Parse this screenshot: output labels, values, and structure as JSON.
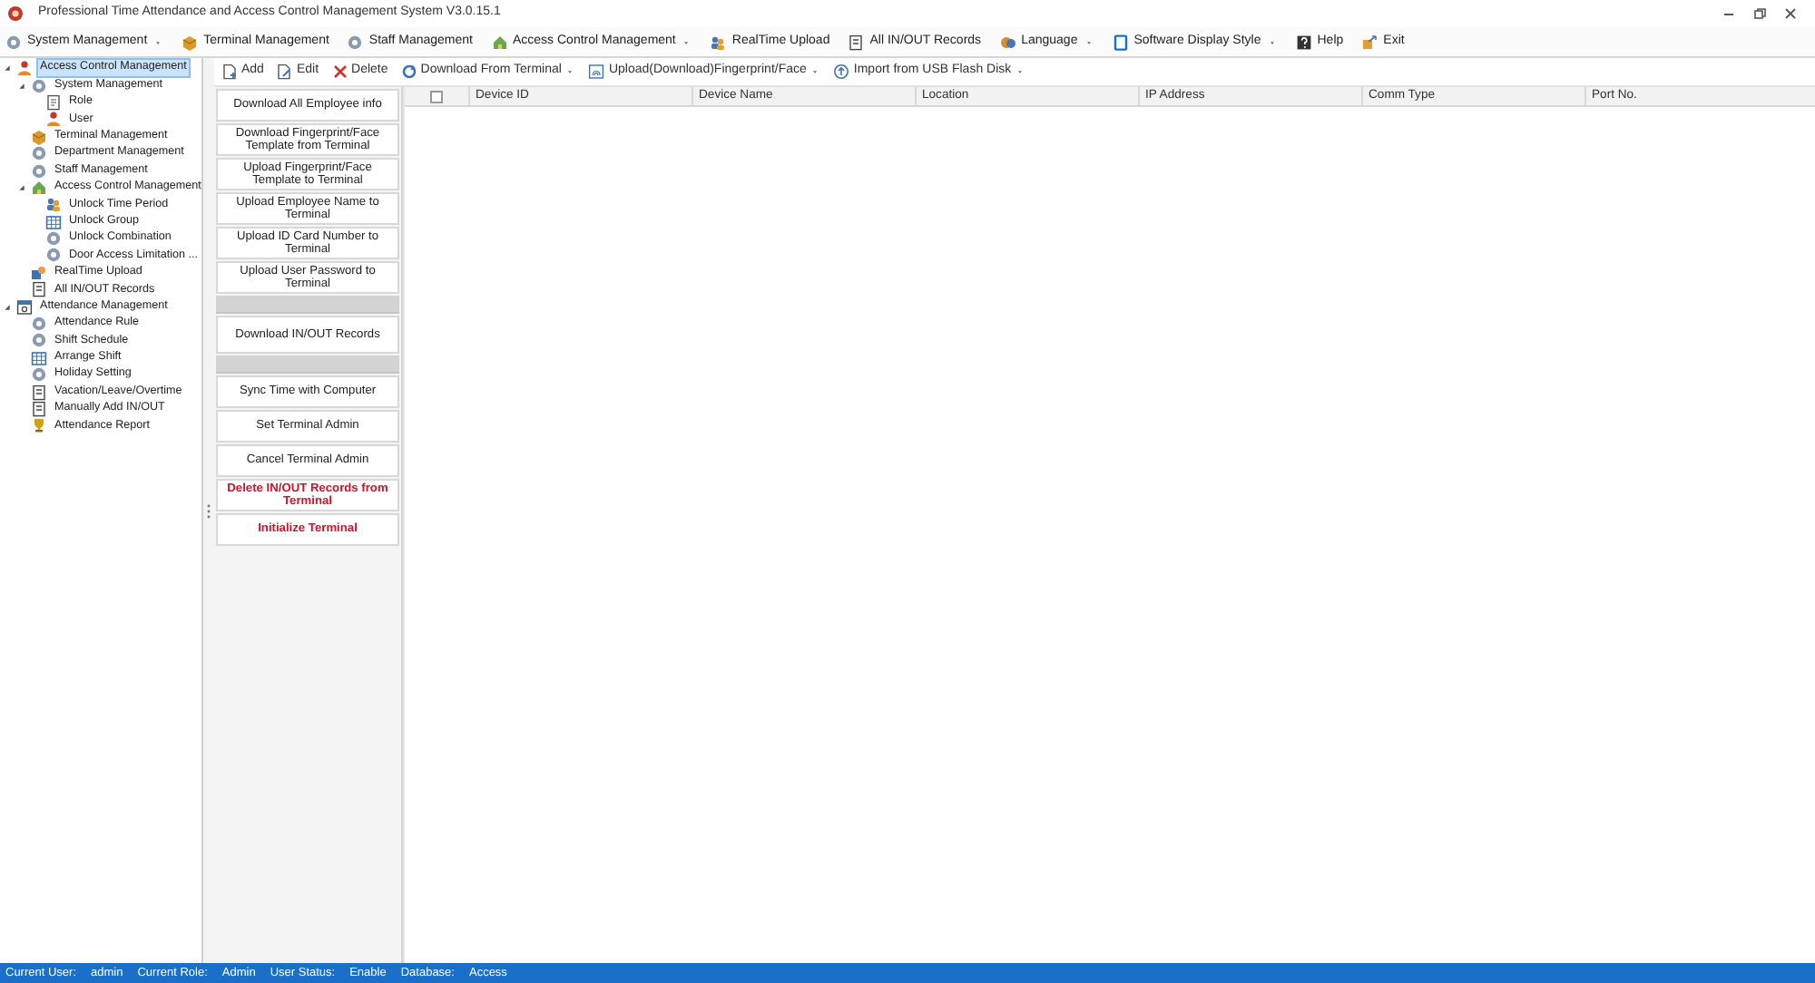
{
  "window": {
    "title": "Professional Time Attendance and Access Control Management System V3.0.15.1"
  },
  "menu": [
    {
      "label": "System Management",
      "dropdown": true
    },
    {
      "label": "Terminal Management",
      "dropdown": false
    },
    {
      "label": "Staff Management",
      "dropdown": false
    },
    {
      "label": "Access Control Management",
      "dropdown": true
    },
    {
      "label": "RealTime Upload",
      "dropdown": false
    },
    {
      "label": "All IN/OUT Records",
      "dropdown": false
    },
    {
      "label": "Language",
      "dropdown": true
    },
    {
      "label": "Software Display Style",
      "dropdown": true
    },
    {
      "label": "Help",
      "dropdown": false
    },
    {
      "label": "Exit",
      "dropdown": false
    }
  ],
  "tree": [
    {
      "label": "Access Control Management",
      "selected": true,
      "expanded": true,
      "children": [
        {
          "label": "System Management",
          "selected": false,
          "expanded": true,
          "children": [
            {
              "label": "Role",
              "selected": false
            },
            {
              "label": "User",
              "selected": false
            }
          ]
        },
        {
          "label": "Terminal Management",
          "selected": false
        },
        {
          "label": "Department Management",
          "selected": false
        },
        {
          "label": "Staff Management",
          "selected": false
        },
        {
          "label": "Access Control Management",
          "selected": false,
          "expanded": true,
          "children": [
            {
              "label": "Unlock Time Period",
              "selected": false
            },
            {
              "label": "Unlock Group",
              "selected": false
            },
            {
              "label": "Unlock Combination",
              "selected": false
            },
            {
              "label": "Door Access Limitation ...",
              "selected": false
            }
          ]
        },
        {
          "label": "RealTime Upload",
          "selected": false
        },
        {
          "label": "All IN/OUT Records",
          "selected": false
        }
      ]
    },
    {
      "label": "Attendance Management",
      "selected": false,
      "expanded": true,
      "children": [
        {
          "label": "Attendance Rule",
          "selected": false
        },
        {
          "label": "Shift Schedule",
          "selected": false
        },
        {
          "label": "Arrange Shift",
          "selected": false
        },
        {
          "label": "Holiday Setting",
          "selected": false
        },
        {
          "label": "Vacation/Leave/Overtime",
          "selected": false
        },
        {
          "label": "Manually Add IN/OUT",
          "selected": false
        },
        {
          "label": "Attendance Report",
          "selected": false
        }
      ]
    }
  ],
  "toolbar": [
    {
      "label": "Add",
      "dropdown": false
    },
    {
      "label": "Edit",
      "dropdown": false
    },
    {
      "label": "Delete",
      "dropdown": false
    },
    {
      "label": "Download From Terminal",
      "dropdown": true
    },
    {
      "label": "Upload(Download)Fingerprint/Face",
      "dropdown": true
    },
    {
      "label": "Import from USB Flash Disk",
      "dropdown": true
    }
  ],
  "actions": [
    {
      "kind": "button",
      "label": "Download All Employee info"
    },
    {
      "kind": "button",
      "label": "Download Fingerprint/Face Template from Terminal"
    },
    {
      "kind": "button",
      "label": "Upload Fingerprint/Face Template to Terminal"
    },
    {
      "kind": "button",
      "label": "Upload Employee Name to Terminal"
    },
    {
      "kind": "button",
      "label": "Upload ID Card Number to Terminal"
    },
    {
      "kind": "button",
      "label": "Upload User Password to Terminal"
    },
    {
      "kind": "separator"
    },
    {
      "kind": "tall",
      "label": "Download IN/OUT Records"
    },
    {
      "kind": "separator"
    },
    {
      "kind": "button",
      "label": "Sync Time with Computer"
    },
    {
      "kind": "button",
      "label": "Set Terminal Admin"
    },
    {
      "kind": "button",
      "label": "Cancel Terminal Admin"
    },
    {
      "kind": "danger",
      "label": "Delete IN/OUT Records from Terminal"
    },
    {
      "kind": "danger",
      "label": "Initialize Terminal"
    }
  ],
  "table": {
    "select_all": {
      "checked": false
    },
    "columns": [
      "Device ID",
      "Device Name",
      "Location",
      "IP Address",
      "Comm Type",
      "Port No."
    ]
  },
  "status_bar": [
    {
      "label": "Current User:",
      "value": "admin"
    },
    {
      "label": "Current Role:",
      "value": "Admin"
    },
    {
      "label": "User Status:",
      "value": "Enable"
    },
    {
      "label": "Database:",
      "value": "Access"
    }
  ]
}
